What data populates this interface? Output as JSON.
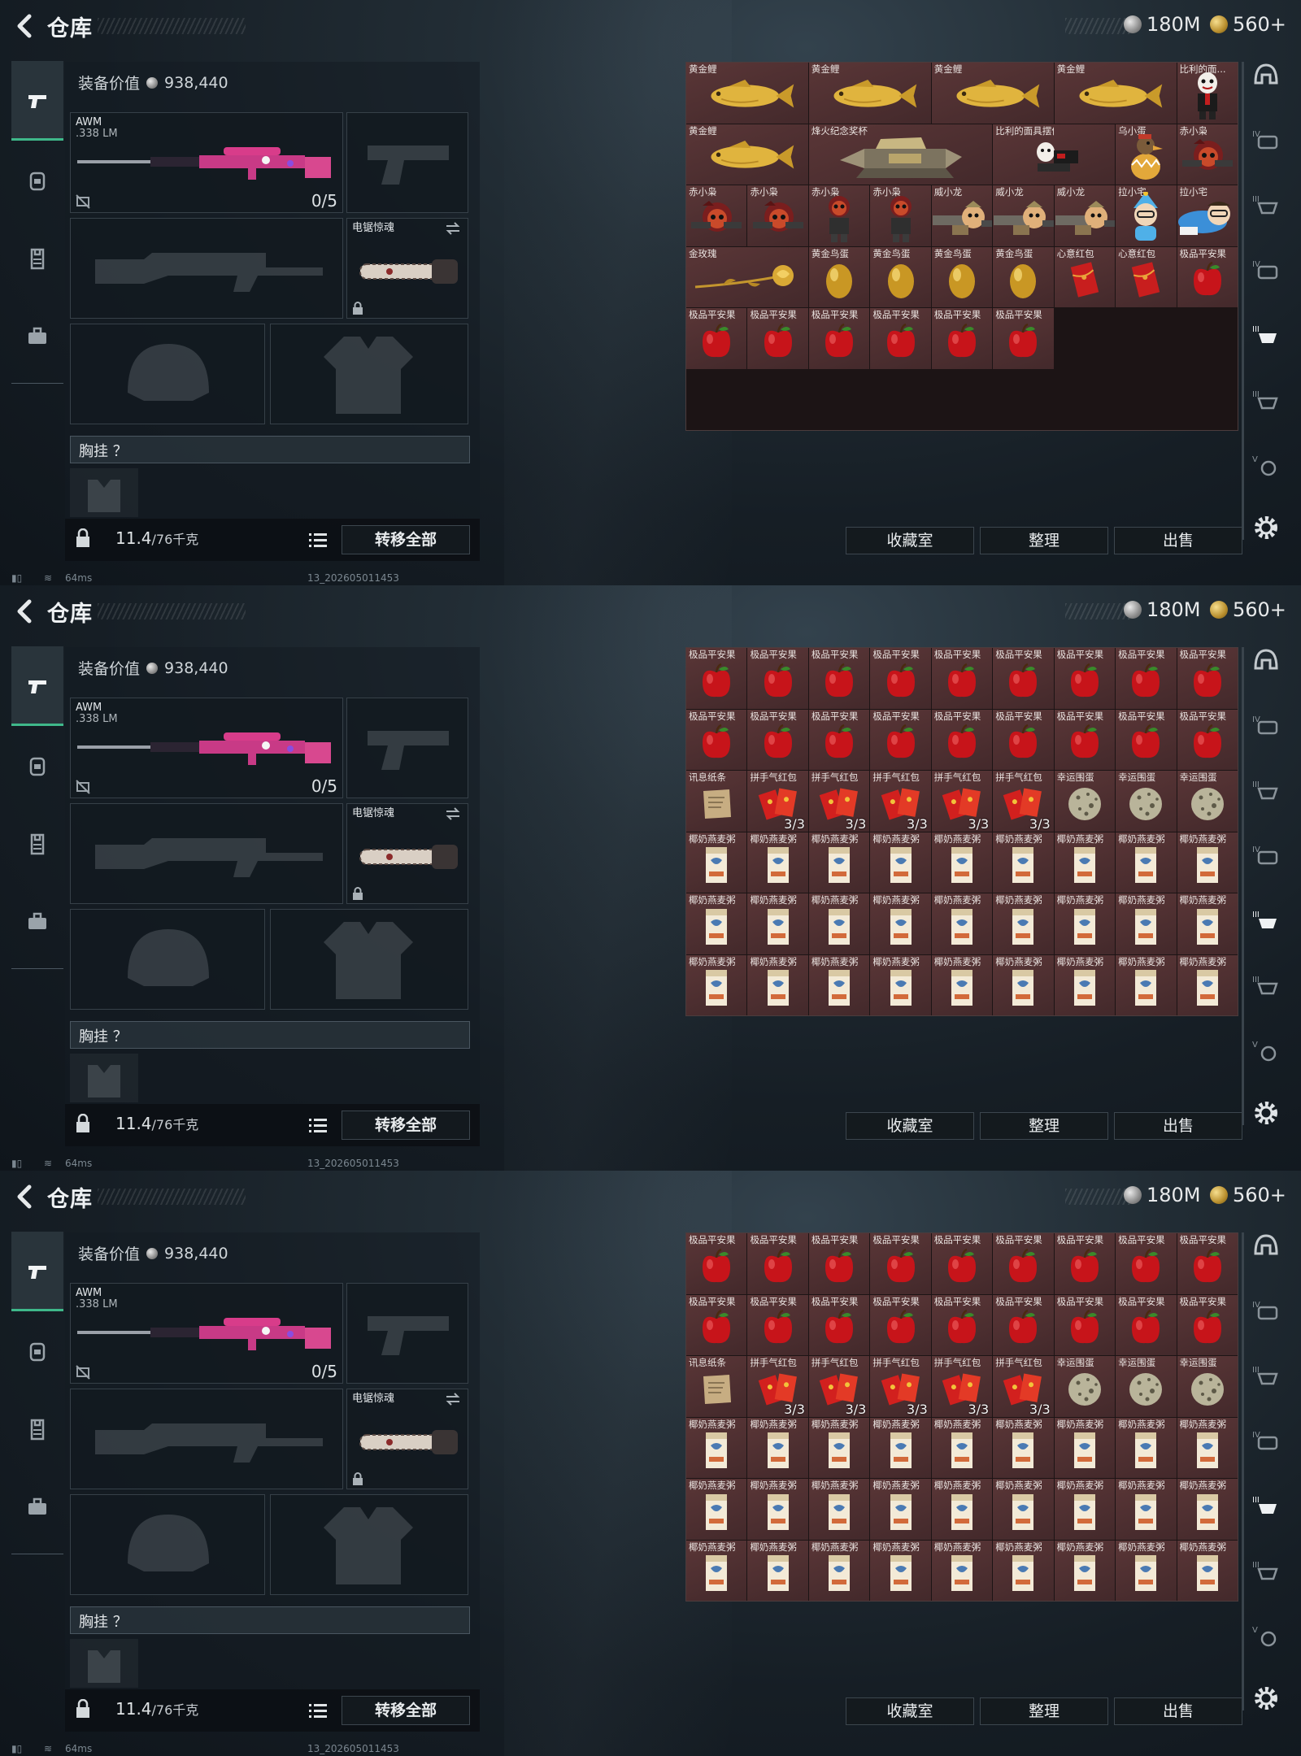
{
  "panels": [
    {
      "title": "仓库",
      "currency": {
        "silver": "180M",
        "gold": "560+"
      },
      "equip_value_label": "装备价值",
      "equip_value": "938,440",
      "primary": {
        "name": "AWM",
        "ammo": ".338 LM",
        "count": "0/5"
      },
      "melee": {
        "name": "电锯惊魂"
      },
      "chest_label": "胸挂 ？",
      "weight": {
        "value": "11.4",
        "max": "/76千克"
      },
      "transfer_all": "转移全部",
      "buttons": {
        "collection": "收藏室",
        "sort": "整理",
        "sell": "出售"
      },
      "footer": {
        "ping": "64ms",
        "build": "13_202605011453"
      },
      "grid_icons": [
        "koi",
        "koi",
        "koi",
        "koi",
        "doll",
        "koi",
        "trophy",
        "trophy",
        "doll2",
        "duck",
        "owl",
        "owl",
        "owl",
        "owl2",
        "owl2",
        "dragon",
        "dragon",
        "dragon",
        "owl2",
        "otaku",
        "otaku",
        "rose",
        "rose",
        "egg",
        "egg",
        "egg",
        "otaku2",
        "egg",
        "envelope",
        "envelope",
        "apple",
        "apple",
        "apple",
        "apple",
        "apple",
        "apple",
        "apple",
        "apple"
      ],
      "grid": [
        {
          "n": "黄金鲤",
          "i": "koi",
          "s": 2
        },
        {
          "n": "黄金鲤",
          "i": "koi",
          "s": 2
        },
        {
          "n": "黄金鲤",
          "i": "koi",
          "s": 2
        },
        {
          "n": "黄金鲤",
          "i": "koi",
          "s": 2
        },
        {
          "n": "比利的面...",
          "i": "doll",
          "s": 1
        },
        {
          "n": "黄金鲤",
          "i": "koi",
          "s": 2
        },
        {
          "n": "烽火纪念奖杯",
          "i": "trophy",
          "s": 3
        },
        {
          "n": "比利的面具摆件",
          "i": "doll2",
          "s": 2
        },
        {
          "n": "乌小蛋",
          "i": "duck",
          "s": 1
        },
        {
          "n": "赤小枭",
          "i": "owl",
          "s": 1
        },
        {
          "n": "赤小枭",
          "i": "owl",
          "s": 1
        },
        {
          "n": "赤小枭",
          "i": "owl",
          "s": 1
        },
        {
          "n": "赤小枭",
          "i": "owl2",
          "s": 1
        },
        {
          "n": "赤小枭",
          "i": "owl2",
          "s": 1
        },
        {
          "n": "威小龙",
          "i": "dragon",
          "s": 1
        },
        {
          "n": "威小龙",
          "i": "dragon",
          "s": 1
        },
        {
          "n": "威小龙",
          "i": "dragon",
          "s": 1
        },
        {
          "n": "拉小宅",
          "i": "otaku2",
          "s": 1
        },
        {
          "n": "拉小宅",
          "i": "otaku",
          "s": 1
        },
        {
          "n": "金玫瑰",
          "i": "rose",
          "s": 2
        },
        {
          "n": "黄金鸟蛋",
          "i": "egg",
          "s": 1
        },
        {
          "n": "黄金鸟蛋",
          "i": "egg",
          "s": 1
        },
        {
          "n": "黄金鸟蛋",
          "i": "egg",
          "s": 1
        },
        {
          "n": "黄金鸟蛋",
          "i": "egg",
          "s": 1
        },
        {
          "n": "心意红包",
          "i": "envelope",
          "s": 1
        },
        {
          "n": "心意红包",
          "i": "envelope",
          "s": 1
        },
        {
          "n": "极品平安果",
          "i": "apple",
          "s": 1
        },
        {
          "n": "极品平安果",
          "i": "apple",
          "s": 1
        },
        {
          "n": "极品平安果",
          "i": "apple",
          "s": 1
        },
        {
          "n": "极品平安果",
          "i": "apple",
          "s": 1
        },
        {
          "n": "极品平安果",
          "i": "apple",
          "s": 1
        },
        {
          "n": "极品平安果",
          "i": "apple",
          "s": 1
        },
        {
          "n": "极品平安果",
          "i": "apple",
          "s": 1
        }
      ]
    },
    {
      "title": "仓库",
      "currency": {
        "silver": "180M",
        "gold": "560+"
      },
      "equip_value_label": "装备价值",
      "equip_value": "938,440",
      "primary": {
        "name": "AWM",
        "ammo": ".338 LM",
        "count": "0/5"
      },
      "melee": {
        "name": "电锯惊魂"
      },
      "chest_label": "胸挂 ？",
      "weight": {
        "value": "11.4",
        "max": "/76千克"
      },
      "transfer_all": "转移全部",
      "buttons": {
        "collection": "收藏室",
        "sort": "整理",
        "sell": "出售"
      },
      "footer": {
        "ping": "64ms",
        "build": "13_202605011453"
      },
      "grid": [
        {
          "n": "极品平安果",
          "i": "apple"
        },
        {
          "n": "极品平安果",
          "i": "apple"
        },
        {
          "n": "极品平安果",
          "i": "apple"
        },
        {
          "n": "极品平安果",
          "i": "apple"
        },
        {
          "n": "极品平安果",
          "i": "apple"
        },
        {
          "n": "极品平安果",
          "i": "apple"
        },
        {
          "n": "极品平安果",
          "i": "apple"
        },
        {
          "n": "极品平安果",
          "i": "apple"
        },
        {
          "n": "极品平安果",
          "i": "apple"
        },
        {
          "n": "极品平安果",
          "i": "apple"
        },
        {
          "n": "极品平安果",
          "i": "apple"
        },
        {
          "n": "极品平安果",
          "i": "apple"
        },
        {
          "n": "极品平安果",
          "i": "apple"
        },
        {
          "n": "极品平安果",
          "i": "apple"
        },
        {
          "n": "极品平安果",
          "i": "apple"
        },
        {
          "n": "极品平安果",
          "i": "apple"
        },
        {
          "n": "极品平安果",
          "i": "apple"
        },
        {
          "n": "极品平安果",
          "i": "apple"
        },
        {
          "n": "讯息纸条",
          "i": "note"
        },
        {
          "n": "拼手气红包",
          "i": "redpack",
          "q": "3/3"
        },
        {
          "n": "拼手气红包",
          "i": "redpack",
          "q": "3/3"
        },
        {
          "n": "拼手气红包",
          "i": "redpack",
          "q": "3/3"
        },
        {
          "n": "拼手气红包",
          "i": "redpack",
          "q": "3/3"
        },
        {
          "n": "拼手气红包",
          "i": "redpack",
          "q": "3/3"
        },
        {
          "n": "幸运围蛋",
          "i": "speckegg"
        },
        {
          "n": "幸运围蛋",
          "i": "speckegg"
        },
        {
          "n": "幸运围蛋",
          "i": "speckegg"
        },
        {
          "n": "椰奶燕麦粥",
          "i": "cereal"
        },
        {
          "n": "椰奶燕麦粥",
          "i": "cereal"
        },
        {
          "n": "椰奶燕麦粥",
          "i": "cereal"
        },
        {
          "n": "椰奶燕麦粥",
          "i": "cereal"
        },
        {
          "n": "椰奶燕麦粥",
          "i": "cereal"
        },
        {
          "n": "椰奶燕麦粥",
          "i": "cereal"
        },
        {
          "n": "椰奶燕麦粥",
          "i": "cereal"
        },
        {
          "n": "椰奶燕麦粥",
          "i": "cereal"
        },
        {
          "n": "椰奶燕麦粥",
          "i": "cereal"
        },
        {
          "n": "椰奶燕麦粥",
          "i": "cereal"
        },
        {
          "n": "椰奶燕麦粥",
          "i": "cereal"
        },
        {
          "n": "椰奶燕麦粥",
          "i": "cereal"
        },
        {
          "n": "椰奶燕麦粥",
          "i": "cereal"
        },
        {
          "n": "椰奶燕麦粥",
          "i": "cereal"
        },
        {
          "n": "椰奶燕麦粥",
          "i": "cereal"
        },
        {
          "n": "椰奶燕麦粥",
          "i": "cereal"
        },
        {
          "n": "椰奶燕麦粥",
          "i": "cereal"
        },
        {
          "n": "椰奶燕麦粥",
          "i": "cereal"
        },
        {
          "n": "椰奶燕麦粥",
          "i": "cereal"
        },
        {
          "n": "椰奶燕麦粥",
          "i": "cereal"
        },
        {
          "n": "椰奶燕麦粥",
          "i": "cereal"
        },
        {
          "n": "椰奶燕麦粥",
          "i": "cereal"
        },
        {
          "n": "椰奶燕麦粥",
          "i": "cereal"
        },
        {
          "n": "椰奶燕麦粥",
          "i": "cereal"
        },
        {
          "n": "椰奶燕麦粥",
          "i": "cereal"
        },
        {
          "n": "椰奶燕麦粥",
          "i": "cereal"
        },
        {
          "n": "椰奶燕麦粥",
          "i": "cereal"
        }
      ]
    },
    {
      "title": "仓库",
      "currency": {
        "silver": "180M",
        "gold": "560+"
      },
      "equip_value_label": "装备价值",
      "equip_value": "938,440",
      "primary": {
        "name": "AWM",
        "ammo": ".338 LM",
        "count": "0/5"
      },
      "melee": {
        "name": "电锯惊魂"
      },
      "chest_label": "胸挂 ？",
      "weight": {
        "value": "11.4",
        "max": "/76千克"
      },
      "transfer_all": "转移全部",
      "buttons": {
        "collection": "收藏室",
        "sort": "整理",
        "sell": "出售"
      },
      "footer": {
        "ping": "64ms",
        "build": "13_202605011453"
      },
      "grid": [
        {
          "n": "极品平安果",
          "i": "apple"
        },
        {
          "n": "极品平安果",
          "i": "apple"
        },
        {
          "n": "极品平安果",
          "i": "apple"
        },
        {
          "n": "极品平安果",
          "i": "apple"
        },
        {
          "n": "极品平安果",
          "i": "apple"
        },
        {
          "n": "极品平安果",
          "i": "apple"
        },
        {
          "n": "极品平安果",
          "i": "apple"
        },
        {
          "n": "极品平安果",
          "i": "apple"
        },
        {
          "n": "极品平安果",
          "i": "apple"
        },
        {
          "n": "极品平安果",
          "i": "apple"
        },
        {
          "n": "极品平安果",
          "i": "apple"
        },
        {
          "n": "极品平安果",
          "i": "apple"
        },
        {
          "n": "极品平安果",
          "i": "apple"
        },
        {
          "n": "极品平安果",
          "i": "apple"
        },
        {
          "n": "极品平安果",
          "i": "apple"
        },
        {
          "n": "极品平安果",
          "i": "apple"
        },
        {
          "n": "极品平安果",
          "i": "apple"
        },
        {
          "n": "极品平安果",
          "i": "apple"
        },
        {
          "n": "讯息纸条",
          "i": "note"
        },
        {
          "n": "拼手气红包",
          "i": "redpack",
          "q": "3/3"
        },
        {
          "n": "拼手气红包",
          "i": "redpack",
          "q": "3/3"
        },
        {
          "n": "拼手气红包",
          "i": "redpack",
          "q": "3/3"
        },
        {
          "n": "拼手气红包",
          "i": "redpack",
          "q": "3/3"
        },
        {
          "n": "拼手气红包",
          "i": "redpack",
          "q": "3/3"
        },
        {
          "n": "幸运围蛋",
          "i": "speckegg"
        },
        {
          "n": "幸运围蛋",
          "i": "speckegg"
        },
        {
          "n": "幸运围蛋",
          "i": "speckegg"
        },
        {
          "n": "椰奶燕麦粥",
          "i": "cereal"
        },
        {
          "n": "椰奶燕麦粥",
          "i": "cereal"
        },
        {
          "n": "椰奶燕麦粥",
          "i": "cereal"
        },
        {
          "n": "椰奶燕麦粥",
          "i": "cereal"
        },
        {
          "n": "椰奶燕麦粥",
          "i": "cereal"
        },
        {
          "n": "椰奶燕麦粥",
          "i": "cereal"
        },
        {
          "n": "椰奶燕麦粥",
          "i": "cereal"
        },
        {
          "n": "椰奶燕麦粥",
          "i": "cereal"
        },
        {
          "n": "椰奶燕麦粥",
          "i": "cereal"
        },
        {
          "n": "椰奶燕麦粥",
          "i": "cereal"
        },
        {
          "n": "椰奶燕麦粥",
          "i": "cereal"
        },
        {
          "n": "椰奶燕麦粥",
          "i": "cereal"
        },
        {
          "n": "椰奶燕麦粥",
          "i": "cereal"
        },
        {
          "n": "椰奶燕麦粥",
          "i": "cereal"
        },
        {
          "n": "椰奶燕麦粥",
          "i": "cereal"
        },
        {
          "n": "椰奶燕麦粥",
          "i": "cereal"
        },
        {
          "n": "椰奶燕麦粥",
          "i": "cereal"
        },
        {
          "n": "椰奶燕麦粥",
          "i": "cereal"
        },
        {
          "n": "椰奶燕麦粥",
          "i": "cereal"
        },
        {
          "n": "椰奶燕麦粥",
          "i": "cereal"
        },
        {
          "n": "椰奶燕麦粥",
          "i": "cereal"
        },
        {
          "n": "椰奶燕麦粥",
          "i": "cereal"
        },
        {
          "n": "椰奶燕麦粥",
          "i": "cereal"
        },
        {
          "n": "椰奶燕麦粥",
          "i": "cereal"
        },
        {
          "n": "椰奶燕麦粥",
          "i": "cereal"
        },
        {
          "n": "椰奶燕麦粥",
          "i": "cereal"
        },
        {
          "n": "椰奶燕麦粥",
          "i": "cereal"
        }
      ]
    }
  ],
  "right_rail_icons": [
    "helmet-icon",
    "armor-iv-icon",
    "armor-iii-icon",
    "armor-iv-icon",
    "armor-iii-icon",
    "armor-iii-icon",
    "armor-v-icon",
    "settings-icon"
  ],
  "colors": {
    "accent_green": "#3fb88a",
    "grid_cell": "#5a3637",
    "text": "#dfe3e6"
  }
}
